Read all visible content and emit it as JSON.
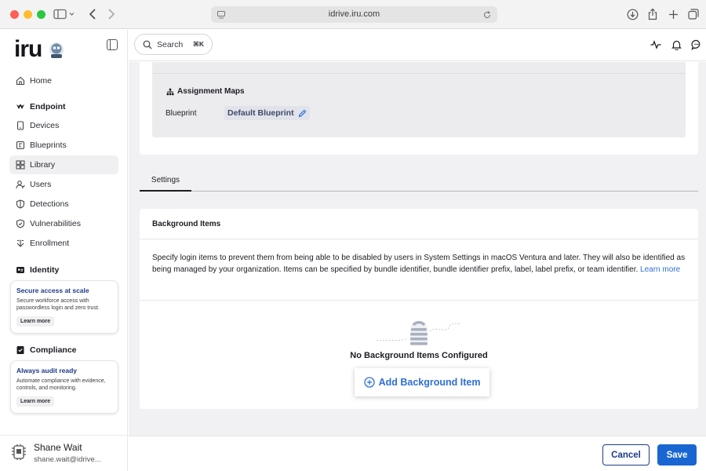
{
  "browser": {
    "url": "idrive.iru.com"
  },
  "sidebar": {
    "logo_text": "iru",
    "home": "Home",
    "endpoint_heading": "Endpoint",
    "endpoint_items": [
      "Devices",
      "Blueprints",
      "Library",
      "Users",
      "Detections",
      "Vulnerabilities",
      "Enrollment"
    ],
    "identity_heading": "Identity",
    "identity_promo": {
      "title": "Secure access at scale",
      "body": "Secure workforce access with passwordless login and zero trust.",
      "button": "Learn more"
    },
    "compliance_heading": "Compliance",
    "compliance_promo": {
      "title": "Always audit ready",
      "body": "Automate compliance with evidence, controls, and monitoring.",
      "button": "Learn more"
    },
    "user": {
      "name": "Shane Wait",
      "email": "shane.wait@idrive..."
    }
  },
  "topbar": {
    "search_label": "Search",
    "search_shortcut": "⌘K"
  },
  "assignment": {
    "title": "Assignment Maps",
    "blueprint_label": "Blueprint",
    "blueprint_value": "Default Blueprint"
  },
  "tabs": [
    "Settings"
  ],
  "background_items": {
    "title": "Background Items",
    "description": "Specify login items to prevent them from being able to be disabled by users in System Settings in macOS Ventura and later. They will also be identified as being managed by your organization. Items can be specified by bundle identifier, bundle identifier prefix, label, label prefix, or team identifier.",
    "learn_more": "Learn more",
    "empty_text": "No Background Items Configured",
    "add_button": "Add Background Item"
  },
  "footer": {
    "cancel": "Cancel",
    "save": "Save"
  },
  "colors": {
    "accent": "#1966d2",
    "link": "#2f6fd6",
    "navy": "#1e3a8a"
  }
}
